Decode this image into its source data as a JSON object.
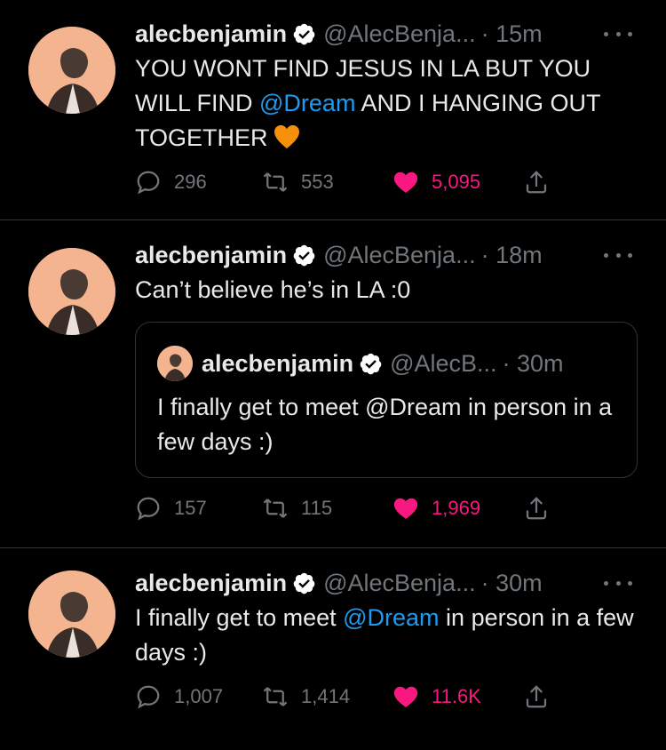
{
  "colors": {
    "background": "#000000",
    "text": "#e7e9ea",
    "muted": "#71767b",
    "mention": "#1d9bf0",
    "like": "#f91880",
    "verified": "#ffffff"
  },
  "tweets": [
    {
      "username": "alecbenjamin",
      "handle": "@AlecBenja...",
      "time": "· 15m",
      "text_parts": [
        "YOU WONT FIND JESUS IN LA BUT YOU WILL FIND ",
        "@Dream",
        " AND I HANGING OUT TOGETHER"
      ],
      "emoji": "orange-heart-icon",
      "replies": "296",
      "retweets": "553",
      "likes": "5,095"
    },
    {
      "username": "alecbenjamin",
      "handle": "@AlecBenja...",
      "time": "· 18m",
      "text": "Can’t believe he’s in LA :0",
      "quote": {
        "username": "alecbenjamin",
        "handle": "@AlecB...",
        "time": "· 30m",
        "text": "I finally get to meet @Dream in person in a few days :)"
      },
      "replies": "157",
      "retweets": "115",
      "likes": "1,969"
    },
    {
      "username": "alecbenjamin",
      "handle": "@AlecBenja...",
      "time": "· 30m",
      "text_parts": [
        "I finally get to meet ",
        "@Dream",
        " in person in a few days :)"
      ],
      "replies": "1,007",
      "retweets": "1,414",
      "likes": "11.6K"
    }
  ]
}
